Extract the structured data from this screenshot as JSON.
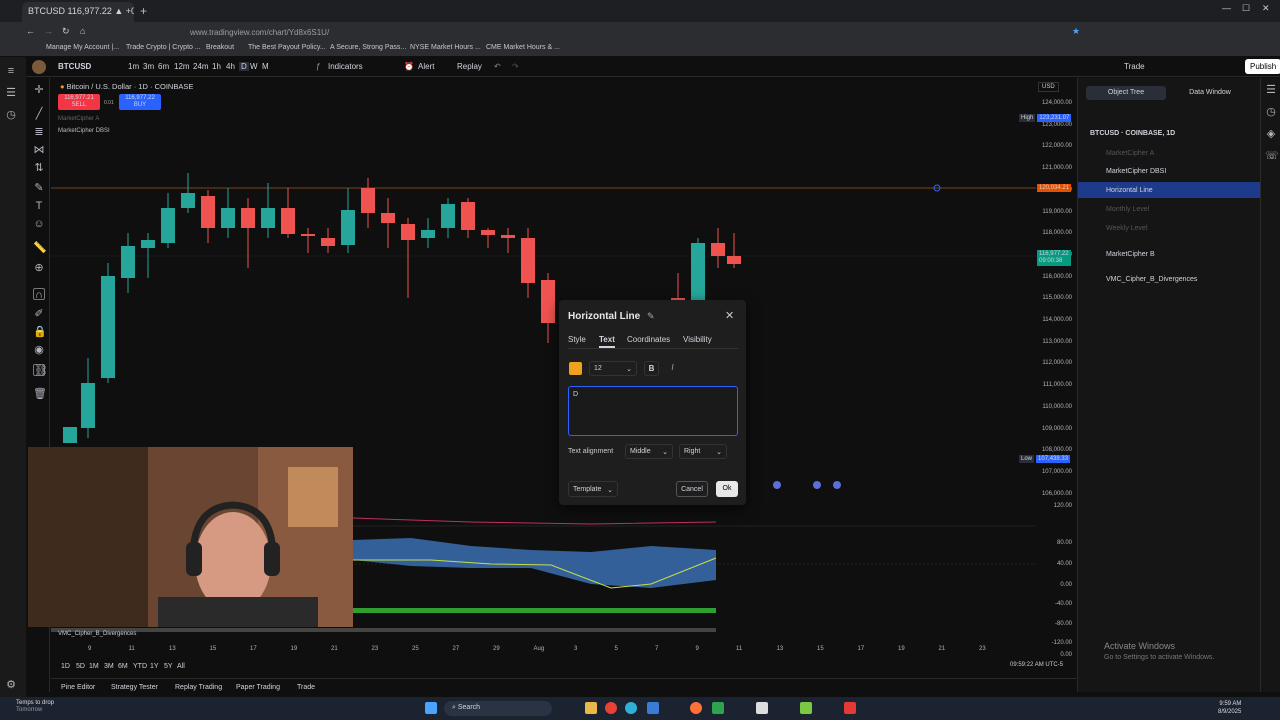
{
  "browser": {
    "tab_title": "BTCUSD 116,977.22 ▲ +0.25%",
    "url": "www.tradingview.com/chart/Yd8x6S1U/",
    "bookmarks": [
      "Manage My Account |...",
      "Trade Crypto | Crypto ...",
      "Breakout",
      "The Best Payout Policy...",
      "A Secure, Strong Pass...",
      "NYSE Market Hours ...",
      "CME Market Hours & ..."
    ]
  },
  "header": {
    "symbol": "BTCUSD",
    "intervals": [
      "1m",
      "3m",
      "6m",
      "12m",
      "24m",
      "1h",
      "4h",
      "D",
      "W",
      "M"
    ],
    "indicators_label": "Indicators",
    "alert_label": "Alert",
    "replay_label": "Replay",
    "trade_label": "Trade",
    "publish_label": "Publish"
  },
  "chart": {
    "title": "Bitcoin / U.S. Dollar · 1D · COINBASE",
    "sell_price": "116,977.21",
    "sell_label": "SELL",
    "spread": "0.01",
    "buy_price": "116,977.22",
    "buy_label": "BUY",
    "indicator1": "MarketCipher A",
    "indicator2": "MarketCipher DBSI",
    "currency": "USD",
    "high_label": "High",
    "high_value": "123,231.07",
    "low_label": "Low",
    "low_value": "107,438.33",
    "hline_value": "120,034.21",
    "last_price": "116,977.22",
    "countdown": "09:00:38",
    "price_ticks": [
      "124,000.00",
      "123,000.00",
      "122,000.00",
      "121,000.00",
      "120,000.00",
      "119,000.00",
      "118,000.00",
      "117,000.00",
      "116,000.00",
      "115,000.00",
      "114,000.00",
      "113,000.00",
      "112,000.00",
      "111,000.00",
      "110,000.00",
      "109,000.00",
      "108,000.00",
      "107,000.00",
      "106,000.00"
    ],
    "osc_ticks": [
      "120.00",
      "80.00",
      "40.00",
      "0.00",
      "-40.00",
      "-80.00",
      "-120.00",
      "0.00"
    ],
    "osc_label": "VMC_Cipher_B_Divergences",
    "time_ticks": [
      "9",
      "11",
      "13",
      "15",
      "17",
      "19",
      "21",
      "23",
      "25",
      "27",
      "29",
      "Aug",
      "3",
      "5",
      "7",
      "9",
      "11",
      "13",
      "15",
      "17",
      "19",
      "21",
      "23"
    ],
    "clock": "09:59:22 AM UTC-5"
  },
  "range_bar": [
    "1D",
    "5D",
    "1M",
    "3M",
    "6M",
    "YTD",
    "1Y",
    "5Y",
    "All"
  ],
  "bottom_tabs": [
    "Pine Editor",
    "Strategy Tester",
    "Replay Trading",
    "Paper Trading",
    "Trade"
  ],
  "right_panel": {
    "tab_object_tree": "Object Tree",
    "tab_data_window": "Data Window",
    "items": [
      "BTCUSD · COINBASE, 1D",
      "MarketCipher A",
      "MarketCipher DBSI",
      "Horizontal Line",
      "Monthly Level",
      "Weekly Level",
      "MarketCipher B",
      "VMC_Cipher_B_Divergences"
    ]
  },
  "dialog": {
    "title": "Horizontal Line",
    "tabs": [
      "Style",
      "Text",
      "Coordinates",
      "Visibility"
    ],
    "font_size": "12",
    "bold": "B",
    "italic": "I",
    "text_value": "D",
    "alignment_label": "Text alignment",
    "v_align": "Middle",
    "h_align": "Right",
    "template_label": "Template",
    "cancel_label": "Cancel",
    "ok_label": "Ok",
    "color": "#f0a020"
  },
  "watermark": {
    "line1": "Activate Windows",
    "line2": "Go to Settings to activate Windows."
  },
  "taskbar": {
    "weather_line1": "Temps to drop",
    "weather_line2": "Tomorrow",
    "search_label": "Search",
    "time": "9:59 AM",
    "date": "8/9/2025"
  }
}
